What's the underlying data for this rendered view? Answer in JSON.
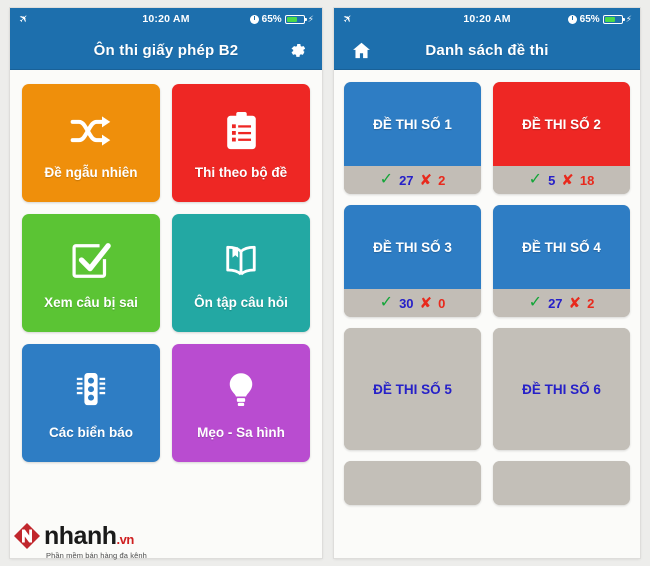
{
  "status_bar": {
    "airplane_icon": "airplane-icon",
    "time": "10:20 AM",
    "alarm_icon": "alarm-clock-icon",
    "battery_percent": "65%",
    "battery_level": 65,
    "charging_icon": "charging-bolt-icon"
  },
  "colors": {
    "nav_blue": "#1d6fad",
    "orange": "#ef8f0b",
    "red": "#ee2724",
    "green": "#5bc434",
    "teal": "#23a8a3",
    "blue": "#2e7dc4",
    "magenta": "#b94cd0",
    "card_blue": "#2e7dc4",
    "card_red": "#ee2724",
    "card_gray": "#c3bfb8",
    "score_correct": "#2620c8",
    "score_wrong": "#e8291c",
    "check_green": "#13a538"
  },
  "home_screen": {
    "nav": {
      "title": "Ôn thi giấy phép B2",
      "settings_icon": "gear-icon"
    },
    "tiles": [
      {
        "label": "Đề ngẫu nhiên",
        "icon": "shuffle-icon",
        "color": "#ef8f0b"
      },
      {
        "label": "Thi theo bộ đề",
        "icon": "clipboard-list-icon",
        "color": "#ee2724"
      },
      {
        "label": "Xem câu bị sai",
        "icon": "check-square-icon",
        "color": "#5bc434"
      },
      {
        "label": "Ôn tập câu hỏi",
        "icon": "open-book-icon",
        "color": "#23a8a3"
      },
      {
        "label": "Các biển báo",
        "icon": "traffic-light-icon",
        "color": "#2e7dc4"
      },
      {
        "label": "Mẹo - Sa hình",
        "icon": "lightbulb-icon",
        "color": "#b94cd0"
      }
    ]
  },
  "exam_list_screen": {
    "nav": {
      "title": "Danh sách đề thi",
      "home_icon": "home-icon"
    },
    "check_glyph": "✓",
    "cross_glyph": "✘",
    "exams": [
      {
        "label": "ĐỀ THI SỐ 1",
        "state": "done",
        "color": "#2e7dc4",
        "correct": "27",
        "wrong": "2"
      },
      {
        "label": "ĐỀ THI SỐ 2",
        "state": "done",
        "color": "#ee2724",
        "correct": "5",
        "wrong": "18"
      },
      {
        "label": "ĐỀ THI SỐ 3",
        "state": "done",
        "color": "#2e7dc4",
        "correct": "30",
        "wrong": "0"
      },
      {
        "label": "ĐỀ THI SỐ 4",
        "state": "done",
        "color": "#2e7dc4",
        "correct": "27",
        "wrong": "2"
      },
      {
        "label": "ĐỀ THI SỐ 5",
        "state": "untaken",
        "color": "#c3bfb8",
        "correct": "",
        "wrong": ""
      },
      {
        "label": "ĐỀ THI SỐ 6",
        "state": "untaken",
        "color": "#c3bfb8",
        "correct": "",
        "wrong": ""
      }
    ]
  },
  "footer": {
    "brand": "nhanh",
    "brand_tld": ".vn",
    "tagline": "Phần mềm bán hàng đa kênh",
    "mark_icon": "nhanh-logo-icon"
  }
}
